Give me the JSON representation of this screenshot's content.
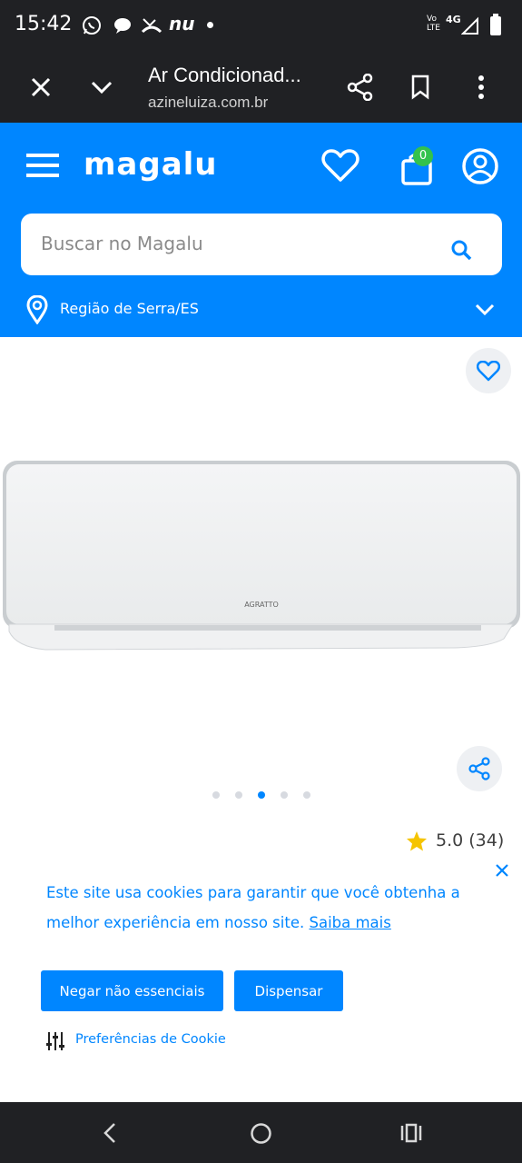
{
  "status_bar": {
    "time": "15:42",
    "icons": [
      "whatsapp-icon",
      "chat-bubble-icon",
      "missed-call-icon",
      "nubank-icon",
      "dot-icon",
      "volte-icon",
      "4g-icon",
      "signal-icon",
      "battery-icon"
    ],
    "nu_label": "nu",
    "volte_label": "Vo LTE",
    "network_label": "4G"
  },
  "browser": {
    "page_title": "Ar Condicionad...",
    "url": "azineluiza.com.br",
    "icons": [
      "close-icon",
      "chevron-down-icon",
      "share-icon",
      "bookmark-icon",
      "more-vert-icon"
    ]
  },
  "header": {
    "logo": "magalu",
    "cart_count": "0",
    "search_placeholder": "Buscar no Magalu",
    "region": "Região de Serra/ES",
    "colors": {
      "brand_blue": "#0086ff",
      "cart_badge": "#33c24d"
    }
  },
  "product": {
    "image_brand": "AGRATTO",
    "carousel_total": 5,
    "carousel_active": 3,
    "rating": "5.0 (34)"
  },
  "cookie_banner": {
    "text": "Este site usa cookies para garantir que você obtenha a melhor experiência em nosso site.",
    "link": "Saiba mais",
    "deny_button": "Negar não essenciais",
    "dismiss_button": "Dispensar",
    "preferences": "Preferências de Cookie"
  },
  "nav_bar": {
    "icons": [
      "back-icon",
      "home-icon",
      "recents-icon"
    ]
  }
}
